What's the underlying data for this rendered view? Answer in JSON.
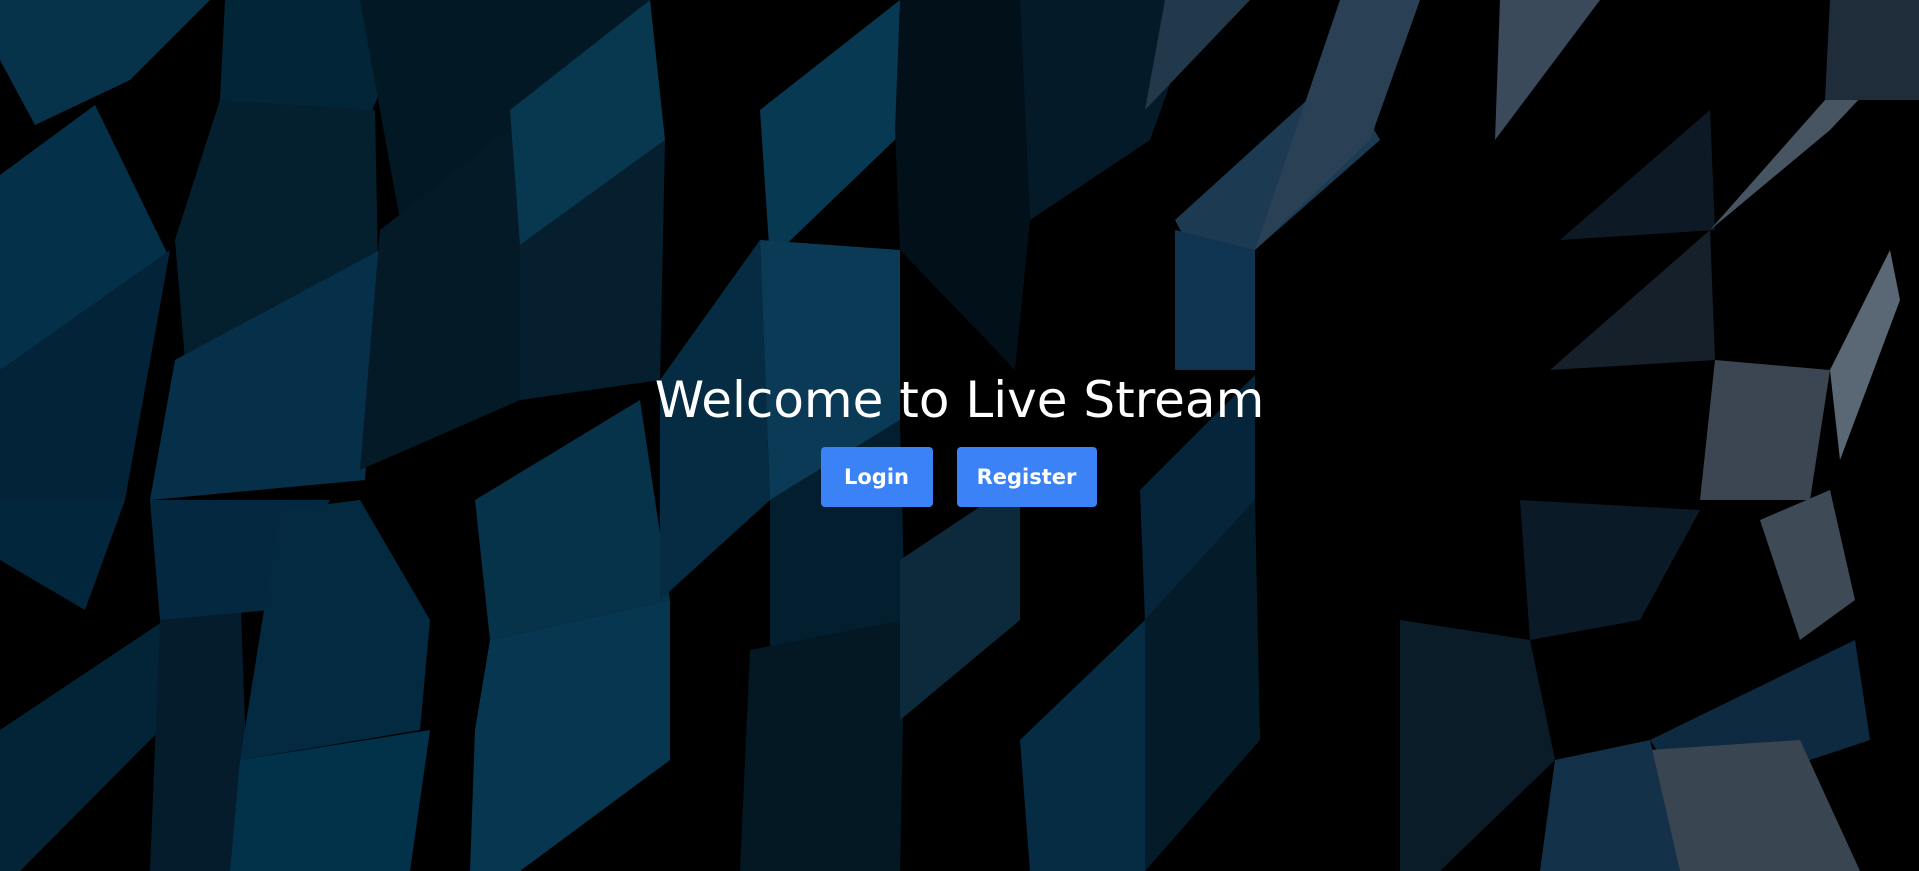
{
  "page": {
    "title": "Welcome to Live Stream"
  },
  "actions": {
    "login_label": "Login",
    "register_label": "Register"
  },
  "colors": {
    "background": "#000000",
    "button": "#3b82f6",
    "button_text": "#ffffff",
    "title_text": "#ffffff",
    "shard_teal": "#0b3a54",
    "shard_dark": "#051622",
    "shard_slate": "#3a4754"
  }
}
